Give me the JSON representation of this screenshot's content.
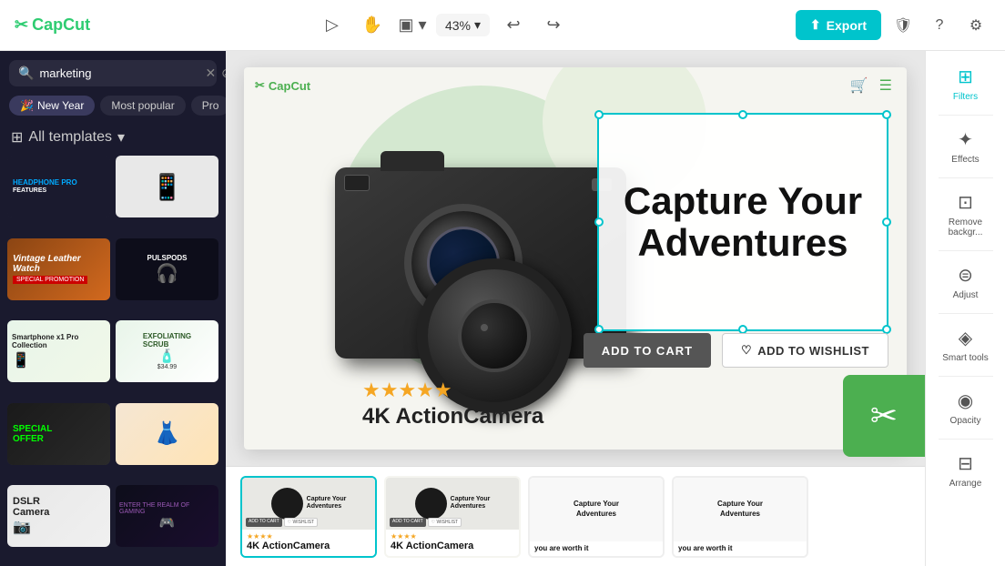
{
  "topbar": {
    "logo": "CapCut",
    "zoom": "43%",
    "export_label": "Export",
    "undo_icon": "↩",
    "redo_icon": "↪"
  },
  "search": {
    "query": "marketing",
    "placeholder": "marketing"
  },
  "filter_chips": [
    {
      "id": "new-year",
      "label": "New Year",
      "icon": "🎉"
    },
    {
      "id": "most-popular",
      "label": "Most popular"
    },
    {
      "id": "pro",
      "label": "Pro"
    }
  ],
  "templates_bar": {
    "label": "All templates",
    "dropdown_icon": "▾"
  },
  "templates": [
    {
      "id": 1,
      "type": "headphone",
      "label": "Headphone Pro"
    },
    {
      "id": 2,
      "type": "phone",
      "label": "Phone"
    },
    {
      "id": 3,
      "type": "vintage",
      "label": "Vintage Leather Watch"
    },
    {
      "id": 4,
      "type": "pulsebuds",
      "label": "Pulse Pods"
    },
    {
      "id": 5,
      "type": "smartphone",
      "label": "Smartphone x1 Pro"
    },
    {
      "id": 6,
      "type": "scrub",
      "label": "Exfoliating Scrub"
    },
    {
      "id": 7,
      "type": "special",
      "label": "Special Offer"
    },
    {
      "id": 8,
      "type": "fashion",
      "label": "Fashion"
    },
    {
      "id": 9,
      "type": "dslr",
      "label": "DSLR Camera"
    },
    {
      "id": 10,
      "type": "gaming",
      "label": "Gaming"
    }
  ],
  "canvas": {
    "logo": "CapCut",
    "main_title": "Capture Your Adventures",
    "subtitle": "4K ActionCamera",
    "stars": "★★★★★",
    "add_to_cart": "ADD TO CART",
    "add_to_wishlist": "ADD TO WISHLIST",
    "zoom": "43%"
  },
  "filmstrip": [
    {
      "id": 1,
      "title": "Capture Your Adventures",
      "sub": "",
      "has_btn": true,
      "product": "4K ActionCamera"
    },
    {
      "id": 2,
      "title": "Capture Your Adventures",
      "sub": "",
      "has_btn": true,
      "product": "4K ActionCamera"
    },
    {
      "id": 3,
      "title": "Capture Your Adventures",
      "sub": "you are worth it",
      "has_btn": false
    },
    {
      "id": 4,
      "title": "Capture Your Adventures",
      "sub": "you are worth it",
      "has_btn": false
    }
  ],
  "right_sidebar": [
    {
      "id": "filters",
      "icon": "⊞",
      "label": "Filters",
      "active": true
    },
    {
      "id": "effects",
      "icon": "✦",
      "label": "Effects"
    },
    {
      "id": "remove-bg",
      "icon": "⊡",
      "label": "Remove backgr..."
    },
    {
      "id": "adjust",
      "icon": "⊜",
      "label": "Adjust"
    },
    {
      "id": "smart-tools",
      "icon": "◈",
      "label": "Smart tools"
    },
    {
      "id": "opacity",
      "icon": "◉",
      "label": "Opacity"
    },
    {
      "id": "arrange",
      "icon": "⊟",
      "label": "Arrange"
    }
  ]
}
